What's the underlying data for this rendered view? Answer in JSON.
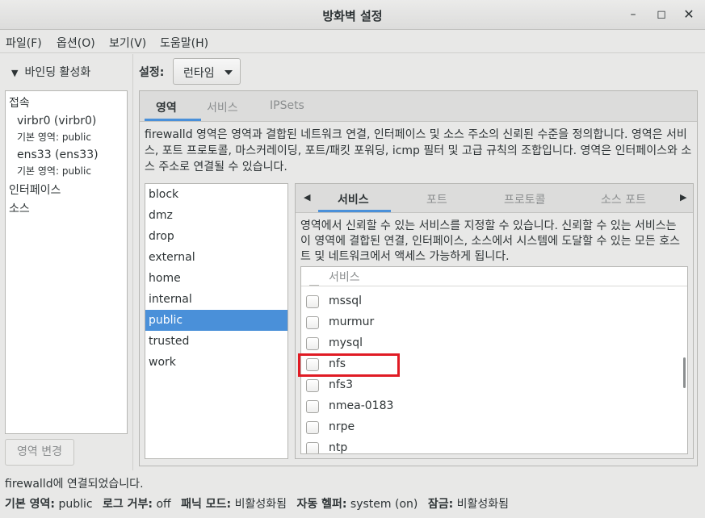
{
  "window": {
    "title": "방화벽 설정"
  },
  "menu": [
    "파일(F)",
    "옵션(O)",
    "보기(V)",
    "도움말(H)"
  ],
  "left": {
    "binding_toggle": "바인딩 활성화",
    "connections_header": "접속",
    "connections": [
      {
        "name": "virbr0 (virbr0)",
        "zone": "기본 영역: public"
      },
      {
        "name": "ens33 (ens33)",
        "zone": "기본 영역: public"
      }
    ],
    "interfaces_header": "인터페이스",
    "sources_header": "소스",
    "change_zone_button": "영역 변경"
  },
  "config": {
    "label": "설정:",
    "value": "런타임"
  },
  "tabs": [
    "영역",
    "서비스",
    "IPSets"
  ],
  "zone_description": "firewalld 영역은 영역과 결합된 네트워크 연결, 인터페이스 및 소스 주소의 신뢰된 수준을 정의합니다. 영역은 서비스, 포트 프로토콜, 마스커레이딩, 포트/패킷 포워딩, icmp 필터 및 고급 규칙의 조합입니다. 영역은 인터페이스와 소스 주소로 연결될 수 있습니다.",
  "zones": [
    "block",
    "dmz",
    "drop",
    "external",
    "home",
    "internal",
    "public",
    "trusted",
    "work"
  ],
  "selected_zone": "public",
  "sub_tabs": [
    "서비스",
    "포트",
    "프로토콜",
    "소스 포트"
  ],
  "service_description": "영역에서 신뢰할 수 있는 서비스를 지정할 수 있습니다. 신뢰할 수 있는 서비스는 이 영역에 결합된 연결, 인터페이스, 소스에서 시스템에 도달할 수 있는 모든 호스트 및 네트워크에서 액세스 가능하게 됩니다.",
  "services_header": "서비스",
  "services": [
    {
      "name": "mssql",
      "checked": false
    },
    {
      "name": "murmur",
      "checked": false
    },
    {
      "name": "mysql",
      "checked": false
    },
    {
      "name": "nfs",
      "checked": false
    },
    {
      "name": "nfs3",
      "checked": false
    },
    {
      "name": "nmea-0183",
      "checked": false
    },
    {
      "name": "nrpe",
      "checked": false
    },
    {
      "name": "ntp",
      "checked": false
    }
  ],
  "status": {
    "connection": "firewalld에 연결되었습니다.",
    "default_zone_label": "기본 영역:",
    "default_zone": "public",
    "log_denied_label": "로그 거부:",
    "log_denied": "off",
    "panic_label": "패닉 모드:",
    "panic": "비활성화됨",
    "helper_label": "자동 헬퍼:",
    "helper": "system (on)",
    "lock_label": "잠금:",
    "lock": "비활성화됨"
  },
  "colors": {
    "accent": "#4a90d9",
    "highlight": "#e01b24"
  }
}
